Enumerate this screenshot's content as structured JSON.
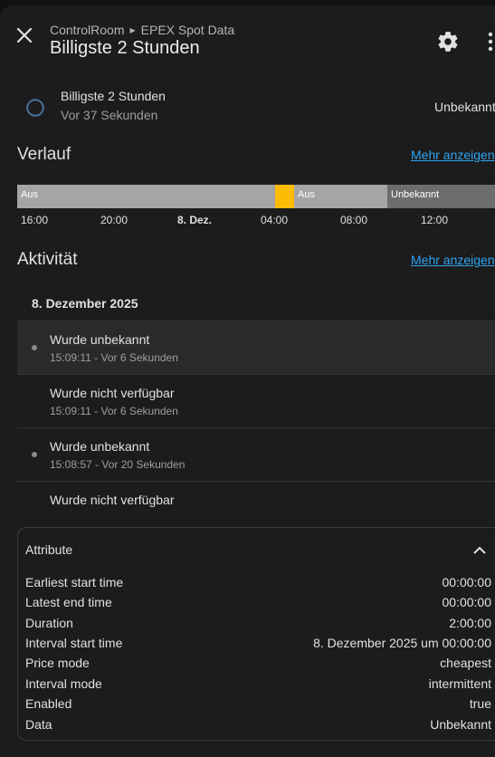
{
  "header": {
    "breadcrumb_parent": "ControlRoom",
    "breadcrumb_child": "EPEX Spot Data",
    "title": "Billigste 2 Stunden"
  },
  "icons": {
    "close": "close-icon",
    "settings": "gear-icon",
    "menu": "more-vertical-icon",
    "state": "circle-outline-icon",
    "collapse": "chevron-up-icon"
  },
  "state": {
    "name": "Billigste 2 Stunden",
    "last_changed": "Vor 37 Sekunden",
    "value": "Unbekannt"
  },
  "history": {
    "title": "Verlauf",
    "more_label": "Mehr anzeigen",
    "segments": [
      {
        "label": "Aus",
        "color": "#a5a5a5"
      },
      {
        "label": "",
        "color": "#fcbc04"
      },
      {
        "label": "Aus",
        "color": "#a5a5a5"
      },
      {
        "label": "Unbekannt",
        "color": "#6d6d6d"
      }
    ],
    "ticks": [
      "16:00",
      "20:00",
      "8. Dez.",
      "04:00",
      "08:00",
      "12:00"
    ]
  },
  "activity": {
    "title": "Aktivität",
    "more_label": "Mehr anzeigen",
    "date": "8. Dezember 2025",
    "entries": [
      {
        "title": "Wurde unbekannt",
        "subtitle": "15:09:11 - Vor 6 Sekunden"
      },
      {
        "title": "Wurde nicht verfügbar",
        "subtitle": "15:09:11 - Vor 6 Sekunden"
      },
      {
        "title": "Wurde unbekannt",
        "subtitle": "15:08:57 - Vor 20 Sekunden"
      },
      {
        "title": "Wurde nicht verfügbar",
        "subtitle": ""
      }
    ]
  },
  "attributes": {
    "title": "Attribute",
    "rows": [
      {
        "key": "Earliest start time",
        "value": "00:00:00"
      },
      {
        "key": "Latest end time",
        "value": "00:00:00"
      },
      {
        "key": "Duration",
        "value": "2:00:00"
      },
      {
        "key": "Interval start time",
        "value": "8. Dezember 2025 um 00:00:00"
      },
      {
        "key": "Price mode",
        "value": "cheapest"
      },
      {
        "key": "Interval mode",
        "value": "intermittent"
      },
      {
        "key": "Enabled",
        "value": "true"
      },
      {
        "key": "Data",
        "value": "Unbekannt"
      }
    ]
  },
  "colors": {
    "accent_link": "#2ea3f2",
    "timeline_off": "#a5a5a5",
    "timeline_on": "#fcbc04",
    "timeline_unknown": "#6d6d6d",
    "state_icon": "#44739e"
  }
}
